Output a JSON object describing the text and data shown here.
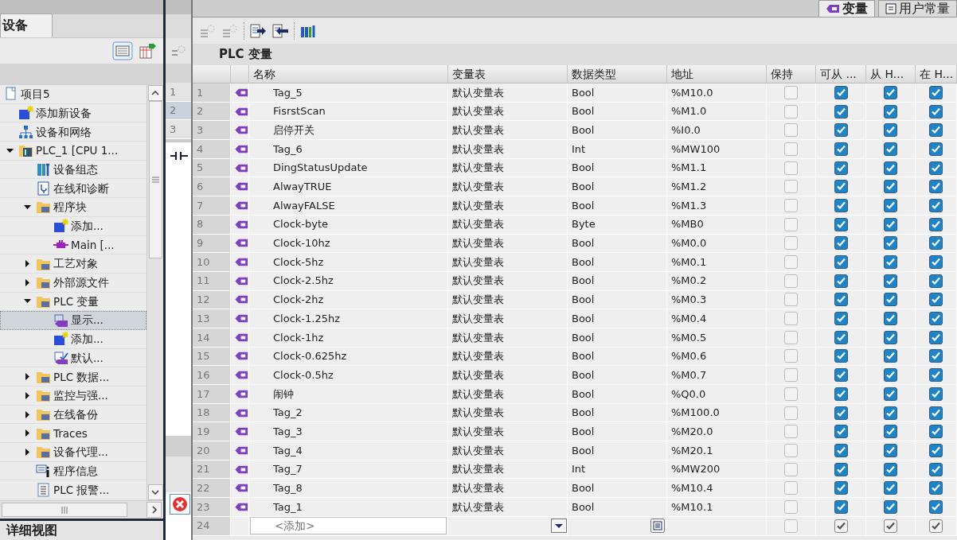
{
  "project_tree": {
    "tab": "设备",
    "detail_view": "详细视图",
    "items": [
      {
        "label": "项目5",
        "kind": "project",
        "selected": false,
        "children": [
          {
            "label": "添加新设备",
            "kind": "add",
            "selected": false
          },
          {
            "label": "设备和网络",
            "kind": "network",
            "selected": false
          },
          {
            "label": "PLC_1 [CPU 1...",
            "kind": "cpu",
            "selected": false,
            "expanded": true,
            "children": [
              {
                "label": "设备组态",
                "kind": "config",
                "selected": false
              },
              {
                "label": "在线和诊断",
                "kind": "diag",
                "selected": false
              },
              {
                "label": "程序块",
                "kind": "folder",
                "selected": false,
                "expanded": true,
                "children": [
                  {
                    "label": "添加...",
                    "kind": "add",
                    "selected": false
                  },
                  {
                    "label": "Main [...",
                    "kind": "block",
                    "selected": false
                  }
                ]
              },
              {
                "label": "工艺对象",
                "kind": "folder",
                "selected": false,
                "expanded": false
              },
              {
                "label": "外部源文件",
                "kind": "folder",
                "selected": false,
                "expanded": false
              },
              {
                "label": "PLC 变量",
                "kind": "folder",
                "selected": false,
                "expanded": true,
                "children": [
                  {
                    "label": "显示...",
                    "kind": "tags",
                    "selected": true
                  },
                  {
                    "label": "添加...",
                    "kind": "add",
                    "selected": false
                  },
                  {
                    "label": "默认...",
                    "kind": "tagcheck",
                    "selected": false
                  }
                ]
              },
              {
                "label": "PLC 数据...",
                "kind": "folder",
                "selected": false,
                "expanded": false
              },
              {
                "label": "监控与强...",
                "kind": "folder",
                "selected": false,
                "expanded": false
              },
              {
                "label": "在线备份",
                "kind": "folder",
                "selected": false,
                "expanded": false
              },
              {
                "label": "Traces",
                "kind": "folder",
                "selected": false,
                "expanded": false
              },
              {
                "label": "设备代理...",
                "kind": "folder",
                "selected": false,
                "expanded": false
              },
              {
                "label": "程序信息",
                "kind": "info",
                "selected": false
              },
              {
                "label": "PLC 报警...",
                "kind": "doc",
                "selected": false
              }
            ]
          }
        ]
      }
    ]
  },
  "middle_strip": {
    "rows": [
      {
        "number": "1",
        "selected": false
      },
      {
        "number": "2",
        "selected": true
      },
      {
        "number": "3",
        "selected": false
      }
    ]
  },
  "editor": {
    "tabs": [
      {
        "label": "变量",
        "selected": true
      },
      {
        "label": "用户常量",
        "selected": false
      }
    ],
    "title": "PLC 变量",
    "columns": [
      "名称",
      "变量表",
      "数据类型",
      "地址",
      "保持",
      "可从 ...",
      "从 H...",
      "在 H..."
    ],
    "rows": [
      {
        "number": "1",
        "name": "Tag_5",
        "table": "默认变量表",
        "type": "Bool",
        "address": "%M10.0",
        "retain": false,
        "accessible": true,
        "writable": true,
        "visible": true
      },
      {
        "number": "2",
        "name": "FisrstScan",
        "table": "默认变量表",
        "type": "Bool",
        "address": "%M1.0",
        "retain": false,
        "accessible": true,
        "writable": true,
        "visible": true
      },
      {
        "number": "3",
        "name": "启停开关",
        "table": "默认变量表",
        "type": "Bool",
        "address": "%I0.0",
        "retain": false,
        "accessible": true,
        "writable": true,
        "visible": true
      },
      {
        "number": "4",
        "name": "Tag_6",
        "table": "默认变量表",
        "type": "Int",
        "address": "%MW100",
        "retain": false,
        "accessible": true,
        "writable": true,
        "visible": true
      },
      {
        "number": "5",
        "name": "DingStatusUpdate",
        "table": "默认变量表",
        "type": "Bool",
        "address": "%M1.1",
        "retain": false,
        "accessible": true,
        "writable": true,
        "visible": true
      },
      {
        "number": "6",
        "name": "AlwayTRUE",
        "table": "默认变量表",
        "type": "Bool",
        "address": "%M1.2",
        "retain": false,
        "accessible": true,
        "writable": true,
        "visible": true
      },
      {
        "number": "7",
        "name": "AlwayFALSE",
        "table": "默认变量表",
        "type": "Bool",
        "address": "%M1.3",
        "retain": false,
        "accessible": true,
        "writable": true,
        "visible": true
      },
      {
        "number": "8",
        "name": "Clock-byte",
        "table": "默认变量表",
        "type": "Byte",
        "address": "%MB0",
        "retain": false,
        "accessible": true,
        "writable": true,
        "visible": true
      },
      {
        "number": "9",
        "name": "Clock-10hz",
        "table": "默认变量表",
        "type": "Bool",
        "address": "%M0.0",
        "retain": false,
        "accessible": true,
        "writable": true,
        "visible": true
      },
      {
        "number": "10",
        "name": "Clock-5hz",
        "table": "默认变量表",
        "type": "Bool",
        "address": "%M0.1",
        "retain": false,
        "accessible": true,
        "writable": true,
        "visible": true
      },
      {
        "number": "11",
        "name": "Clock-2.5hz",
        "table": "默认变量表",
        "type": "Bool",
        "address": "%M0.2",
        "retain": false,
        "accessible": true,
        "writable": true,
        "visible": true
      },
      {
        "number": "12",
        "name": "Clock-2hz",
        "table": "默认变量表",
        "type": "Bool",
        "address": "%M0.3",
        "retain": false,
        "accessible": true,
        "writable": true,
        "visible": true
      },
      {
        "number": "13",
        "name": "Clock-1.25hz",
        "table": "默认变量表",
        "type": "Bool",
        "address": "%M0.4",
        "retain": false,
        "accessible": true,
        "writable": true,
        "visible": true
      },
      {
        "number": "14",
        "name": "Clock-1hz",
        "table": "默认变量表",
        "type": "Bool",
        "address": "%M0.5",
        "retain": false,
        "accessible": true,
        "writable": true,
        "visible": true
      },
      {
        "number": "15",
        "name": "Clock-0.625hz",
        "table": "默认变量表",
        "type": "Bool",
        "address": "%M0.6",
        "retain": false,
        "accessible": true,
        "writable": true,
        "visible": true
      },
      {
        "number": "16",
        "name": "Clock-0.5hz",
        "table": "默认变量表",
        "type": "Bool",
        "address": "%M0.7",
        "retain": false,
        "accessible": true,
        "writable": true,
        "visible": true
      },
      {
        "number": "17",
        "name": "闹钟",
        "table": "默认变量表",
        "type": "Bool",
        "address": "%Q0.0",
        "retain": false,
        "accessible": true,
        "writable": true,
        "visible": true
      },
      {
        "number": "18",
        "name": "Tag_2",
        "table": "默认变量表",
        "type": "Bool",
        "address": "%M100.0",
        "retain": false,
        "accessible": true,
        "writable": true,
        "visible": true
      },
      {
        "number": "19",
        "name": "Tag_3",
        "table": "默认变量表",
        "type": "Bool",
        "address": "%M20.0",
        "retain": false,
        "accessible": true,
        "writable": true,
        "visible": true
      },
      {
        "number": "20",
        "name": "Tag_4",
        "table": "默认变量表",
        "type": "Bool",
        "address": "%M20.1",
        "retain": false,
        "accessible": true,
        "writable": true,
        "visible": true
      },
      {
        "number": "21",
        "name": "Tag_7",
        "table": "默认变量表",
        "type": "Int",
        "address": "%MW200",
        "retain": false,
        "accessible": true,
        "writable": true,
        "visible": true
      },
      {
        "number": "22",
        "name": "Tag_8",
        "table": "默认变量表",
        "type": "Bool",
        "address": "%M10.4",
        "retain": false,
        "accessible": true,
        "writable": true,
        "visible": true
      },
      {
        "number": "23",
        "name": "Tag_1",
        "table": "默认变量表",
        "type": "Bool",
        "address": "%M10.1",
        "retain": false,
        "accessible": true,
        "writable": true,
        "visible": true
      }
    ],
    "add_row": {
      "number": "24",
      "placeholder": "<添加>",
      "retain": false,
      "accessible": true,
      "writable": true,
      "visible": true
    }
  }
}
